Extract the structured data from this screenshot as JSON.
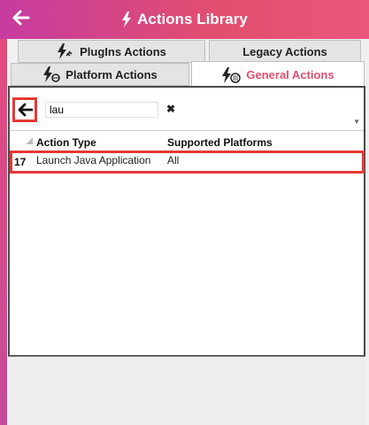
{
  "header": {
    "title": "Actions Library",
    "back_icon": "arrow-left-icon",
    "title_icon": "lightning-icon",
    "gradient": [
      "#c63ba0",
      "#e9567a"
    ]
  },
  "tabs": [
    {
      "label": "PlugIns Actions",
      "icon": "plugin-lightning-icon",
      "selected": false
    },
    {
      "label": "Legacy Actions",
      "icon": "",
      "selected": false
    },
    {
      "label": "Platform Actions",
      "icon": "platform-lightning-icon",
      "selected": false
    },
    {
      "label": "General Actions",
      "icon": "general-lightning-icon",
      "selected": true
    }
  ],
  "search": {
    "value": "lau",
    "clear_icon": "close-icon",
    "back_icon": "arrow-left-icon"
  },
  "grid": {
    "columns": [
      "Action Type",
      "Supported Platforms"
    ],
    "rows": [
      {
        "num": "17",
        "action_type": "Launch Java Application",
        "platforms": "All"
      }
    ]
  },
  "colors": {
    "accent": "#e24f6e",
    "highlight": "#e53935"
  }
}
